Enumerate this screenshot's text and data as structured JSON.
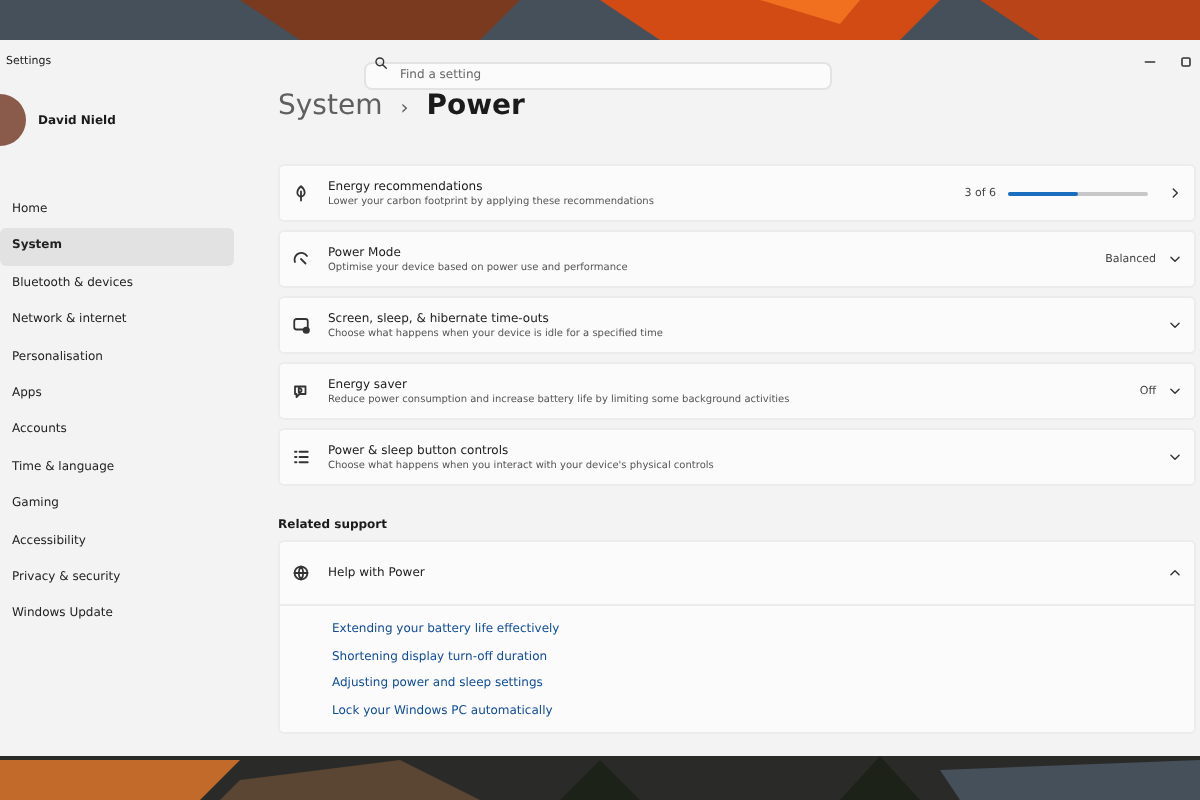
{
  "window": {
    "title": "Settings"
  },
  "search": {
    "placeholder": "Find a setting"
  },
  "user": {
    "name": "David Nield"
  },
  "sidebar": {
    "items": [
      {
        "label": "Home",
        "selected": false
      },
      {
        "label": "System",
        "selected": true
      },
      {
        "label": "Bluetooth & devices",
        "selected": false
      },
      {
        "label": "Network & internet",
        "selected": false
      },
      {
        "label": "Personalisation",
        "selected": false
      },
      {
        "label": "Apps",
        "selected": false
      },
      {
        "label": "Accounts",
        "selected": false
      },
      {
        "label": "Time & language",
        "selected": false
      },
      {
        "label": "Gaming",
        "selected": false
      },
      {
        "label": "Accessibility",
        "selected": false
      },
      {
        "label": "Privacy & security",
        "selected": false
      },
      {
        "label": "Windows Update",
        "selected": false
      }
    ]
  },
  "breadcrumb": {
    "parent": "System",
    "separator": "›",
    "current": "Power"
  },
  "cards": [
    {
      "kind": "link",
      "title": "Energy recommendations",
      "description": "Lower your carbon footprint by applying these recommendations",
      "value": "3 of 6",
      "level": 0.5
    },
    {
      "kind": "expander",
      "title": "Power Mode",
      "description": "Optimise your device based on power use and performance",
      "value": "Balanced",
      "expanded": false
    },
    {
      "kind": "expander",
      "title": "Screen, sleep, & hibernate time-outs",
      "description": "Choose what happens when your device is idle for a specified time",
      "expanded": false
    },
    {
      "kind": "expander",
      "title": "Energy saver",
      "description": "Reduce power consumption and increase battery life by limiting some background activities",
      "value": "Off",
      "expanded": false
    },
    {
      "kind": "expander",
      "title": "Power & sleep button controls",
      "description": "Choose what happens when you interact with your device's physical controls",
      "expanded": false
    }
  ],
  "related_support": {
    "heading": "Related support",
    "title": "Help with Power",
    "expanded": true,
    "links": [
      "Extending your battery life effectively",
      "Shortening display turn-off duration",
      "Adjusting power and sleep settings",
      "Lock your Windows PC automatically"
    ]
  }
}
